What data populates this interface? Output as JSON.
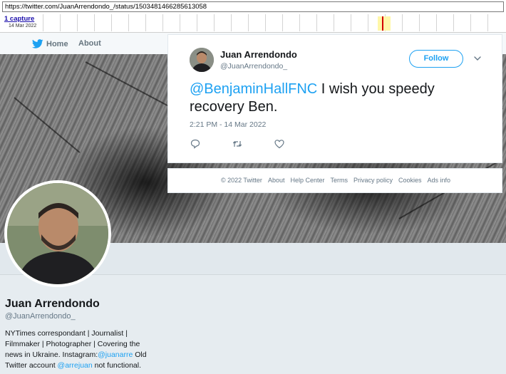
{
  "wayback": {
    "url": "https://twitter.com/JuanArrendondo_/status/1503481466285613058",
    "captures": "1 capture",
    "capture_date": "14 Mar 2022"
  },
  "nav": {
    "home": "Home",
    "about": "About"
  },
  "profile": {
    "name": "Juan Arrendondo",
    "handle": "@JuanArrendondo_",
    "bio_part1": "NYTimes correspondant | Journalist | Filmmaker | Photographer | Covering the news in Ukraine. Instagram:",
    "bio_link1": "@juanarre",
    "bio_part2": " Old Twitter account ",
    "bio_link2": "@arrejuan",
    "bio_part3": " not functional."
  },
  "tweet": {
    "author_name": "Juan Arrendondo",
    "author_handle": "@JuanArrendondo_",
    "follow_label": "Follow",
    "mention": "@BenjaminHallFNC",
    "text": " I wish you speedy recovery Ben.",
    "timestamp": "2:21 PM - 14 Mar 2022"
  },
  "footer": {
    "copyright": "© 2022 Twitter",
    "links": [
      "About",
      "Help Center",
      "Terms",
      "Privacy policy",
      "Cookies",
      "Ads info"
    ]
  },
  "colors": {
    "twitter_blue": "#1da1f2",
    "secondary_text": "#657786",
    "page_bg": "#e6ecf0"
  },
  "icons": {
    "bird": "twitter-bird-icon",
    "reply": "reply-icon",
    "retweet": "retweet-icon",
    "like": "heart-icon",
    "caret": "chevron-down-icon"
  }
}
